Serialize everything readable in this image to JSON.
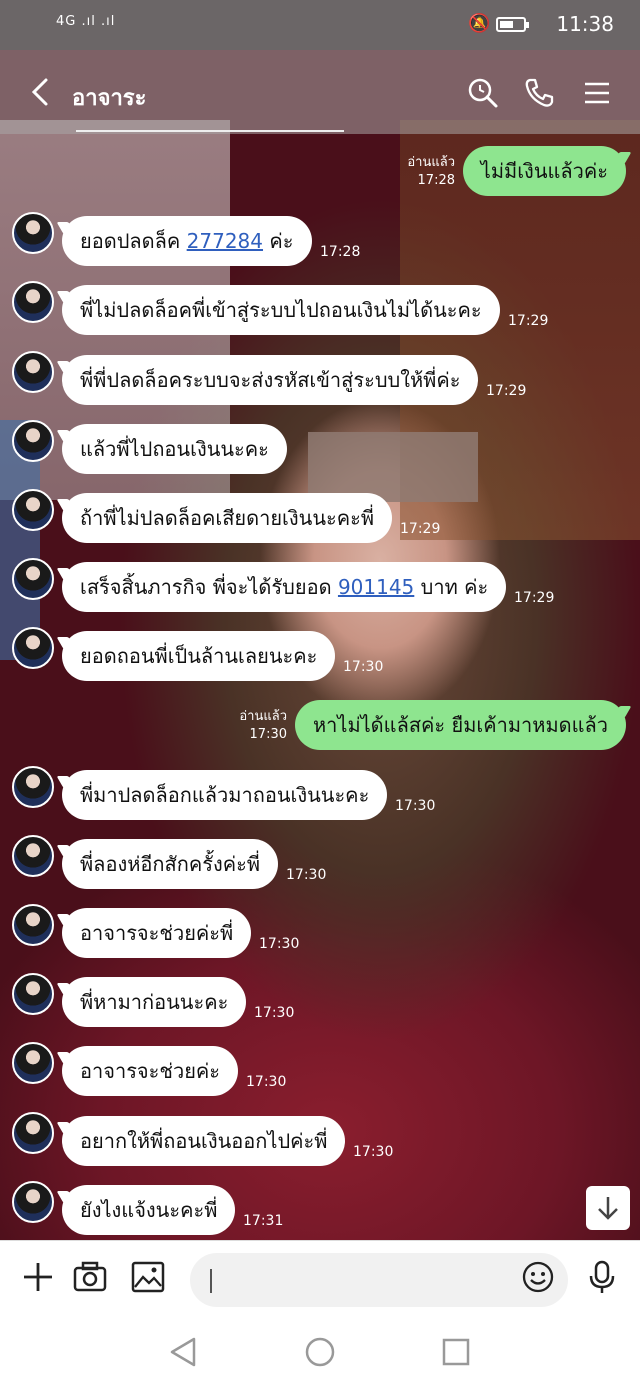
{
  "status_bar": {
    "signal": "4G .ıl .ıl",
    "time": "11:38",
    "battery_level": 0.6
  },
  "header": {
    "title": "อาจาระ",
    "icons": [
      "back-icon",
      "search-icon",
      "phone-icon",
      "menu-icon"
    ]
  },
  "messages": [
    {
      "side": "out",
      "text": "ไม่มีเงินแล้วค่ะ",
      "read": "อ่านแล้ว",
      "time": "17:28"
    },
    {
      "side": "in",
      "pre": "ยอดปลดล็ค ",
      "link": "277284",
      "post": " ค่ะ",
      "time": "17:28"
    },
    {
      "side": "in",
      "text": "พี่ไม่ปลดล็อคพี่เข้าสู่ระบบไปถอนเงินไม่ได้นะคะ",
      "time": "17:29"
    },
    {
      "side": "in",
      "text": "พี่พี่ปลดล็อคระบบจะส่งรหัสเข้าสู่ระบบให้พี่ค่ะ",
      "time": "17:29"
    },
    {
      "side": "in",
      "text": "แล้วพี่ไปถอนเงินนะคะ",
      "time": ""
    },
    {
      "side": "in",
      "text": "ถ้าพี่ไม่ปลดล็อคเสียดายเงินนะคะพี่",
      "time": "17:29"
    },
    {
      "side": "in",
      "pre": "เสร็จสิ้นภารกิจ พี่จะได้รับยอด ",
      "link": "901145",
      "post": " บาท ค่ะ",
      "time": "17:29"
    },
    {
      "side": "in",
      "text": "ยอดถอนพี่เป็นล้านเลยนะคะ",
      "time": "17:30"
    },
    {
      "side": "out",
      "text": "หาไม่ได้แล้สค่ะ ยืมเค้ามาหมดแล้ว",
      "read": "อ่านแล้ว",
      "time": "17:30"
    },
    {
      "side": "in",
      "text": "พี่มาปลดล็อกแล้วมาถอนเงินนะคะ",
      "time": "17:30"
    },
    {
      "side": "in",
      "text": "พี่ลองห่อีกสักครั้งค่ะพี่",
      "time": "17:30"
    },
    {
      "side": "in",
      "text": "อาจารจะช่วยค่ะพี่",
      "time": "17:30"
    },
    {
      "side": "in",
      "text": "พี่หามาก่อนนะคะ",
      "time": "17:30"
    },
    {
      "side": "in",
      "text": "อาจารจะช่วยค่ะ",
      "time": "17:30"
    },
    {
      "side": "in",
      "text": "อยากให้พี่ถอนเงินออกไปค่ะพี่",
      "time": "17:30"
    },
    {
      "side": "in",
      "text": "ยังไงแจ้งนะคะพี่",
      "time": "17:31"
    }
  ],
  "input_bar": {
    "icons": [
      "plus-icon",
      "camera-icon",
      "image-icon",
      "emoji-icon",
      "microphone-icon"
    ],
    "text_value": ""
  },
  "nav_bar": {
    "icons": [
      "back-triangle-icon",
      "home-circle-icon",
      "recents-square-icon"
    ]
  },
  "colors": {
    "incoming_bubble": "#ffffff",
    "outgoing_bubble": "#8ee58f",
    "link": "#2f5fbe"
  }
}
